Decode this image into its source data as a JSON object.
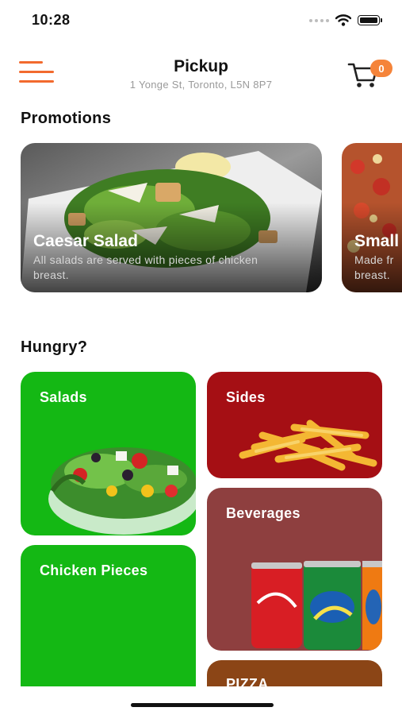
{
  "status_bar": {
    "time": "10:28"
  },
  "header": {
    "title": "Pickup",
    "address": "1 Yonge St, Toronto, L5N 8P7",
    "cart_count": "0"
  },
  "promotions": {
    "title": "Promotions",
    "cards": [
      {
        "title": "Caesar Salad",
        "description": "All salads are served with pieces of chicken breast."
      },
      {
        "title": "Small",
        "description": "Made fr breast."
      }
    ]
  },
  "hungry": {
    "title": "Hungry?",
    "categories": [
      {
        "label": "Salads",
        "color": "#14b814"
      },
      {
        "label": "Sides",
        "color": "#a50f14"
      },
      {
        "label": "Beverages",
        "color": "#8e3f3f"
      },
      {
        "label": "Chicken Pieces",
        "color": "#14b814"
      },
      {
        "label": "PIZZA",
        "color": "#8b4516"
      }
    ]
  },
  "colors": {
    "accent": "#f26a2e",
    "badge": "#f5843a"
  },
  "icons": [
    "menu-icon",
    "cart-icon",
    "wifi-icon",
    "battery-icon",
    "signal-icon"
  ]
}
